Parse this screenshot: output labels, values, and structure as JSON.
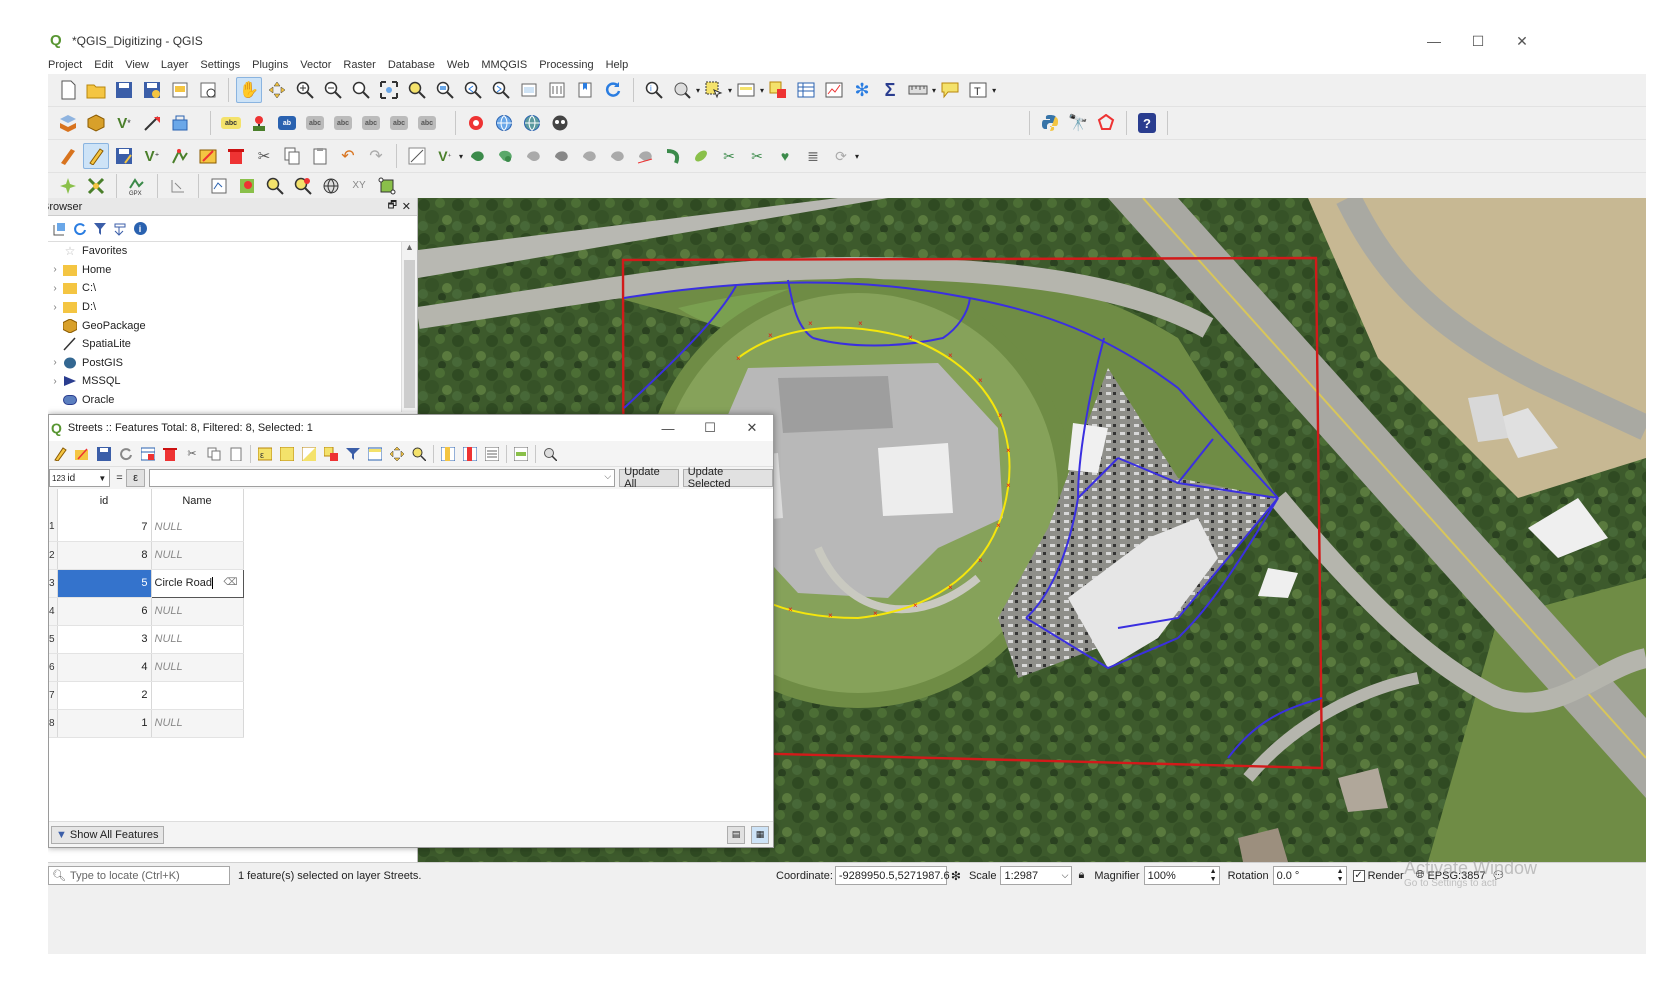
{
  "window": {
    "title": "*QGIS_Digitizing - QGIS",
    "minimize": "—",
    "maximize": "☐",
    "close": "✕"
  },
  "menu": [
    "Project",
    "Edit",
    "View",
    "Layer",
    "Settings",
    "Plugins",
    "Vector",
    "Raster",
    "Database",
    "Web",
    "MMQGIS",
    "Processing",
    "Help"
  ],
  "browser": {
    "title": "Browser",
    "items": [
      {
        "label": "Favorites",
        "icon": "star-icon",
        "expander": false
      },
      {
        "label": "Home",
        "icon": "folder-icon",
        "expander": true
      },
      {
        "label": "C:\\",
        "icon": "folder-icon",
        "expander": true
      },
      {
        "label": "D:\\",
        "icon": "folder-icon",
        "expander": true
      },
      {
        "label": "GeoPackage",
        "icon": "geopackage-icon",
        "expander": false
      },
      {
        "label": "SpatiaLite",
        "icon": "spatialite-icon",
        "expander": false
      },
      {
        "label": "PostGIS",
        "icon": "postgis-icon",
        "expander": true
      },
      {
        "label": "MSSQL",
        "icon": "mssql-icon",
        "expander": true
      },
      {
        "label": "Oracle",
        "icon": "oracle-icon",
        "expander": false
      }
    ]
  },
  "attribute_table": {
    "title": "Streets :: Features Total: 8, Filtered: 8, Selected: 1",
    "field_select": "id",
    "field_type": "123",
    "equals": "=",
    "expression_symbol": "ε",
    "update_all": "Update All",
    "update_selected": "Update Selected",
    "columns": [
      "id",
      "Name"
    ],
    "rows": [
      {
        "num": "1",
        "id": "7",
        "name": "NULL",
        "is_null": true,
        "selected": false,
        "editing": false
      },
      {
        "num": "2",
        "id": "8",
        "name": "NULL",
        "is_null": true,
        "selected": false,
        "editing": false
      },
      {
        "num": "3",
        "id": "5",
        "name": "Circle Road",
        "is_null": false,
        "selected": true,
        "editing": true
      },
      {
        "num": "4",
        "id": "6",
        "name": "NULL",
        "is_null": true,
        "selected": false,
        "editing": false
      },
      {
        "num": "5",
        "id": "3",
        "name": "NULL",
        "is_null": true,
        "selected": false,
        "editing": false
      },
      {
        "num": "6",
        "id": "4",
        "name": "NULL",
        "is_null": true,
        "selected": false,
        "editing": false
      },
      {
        "num": "7",
        "id": "2",
        "name": "",
        "is_null": false,
        "selected": false,
        "editing": false
      },
      {
        "num": "8",
        "id": "1",
        "name": "NULL",
        "is_null": true,
        "selected": false,
        "editing": false
      }
    ],
    "show_all_features": "Show All Features"
  },
  "statusbar": {
    "locator_placeholder": "Type to locate (Ctrl+K)",
    "message": "1 feature(s) selected on layer Streets.",
    "coordinate_label": "Coordinate",
    "coordinate_value": "-9289950.5,5271987.6",
    "scale_label": "Scale",
    "scale_value": "1:2987",
    "magnifier_label": "Magnifier",
    "magnifier_value": "100%",
    "rotation_label": "Rotation",
    "rotation_value": "0.0 °",
    "render_label": "Render",
    "crs": "EPSG:3857"
  },
  "watermark": {
    "line1": "Activate Window",
    "line2": "Go to Settings to acti"
  },
  "colors": {
    "qgis_green": "#589632",
    "selection_blue": "#3473cc",
    "extent_red": "#d21a1a",
    "street_blue": "#3a2fe0",
    "circle_yellow": "#f5e60c"
  }
}
